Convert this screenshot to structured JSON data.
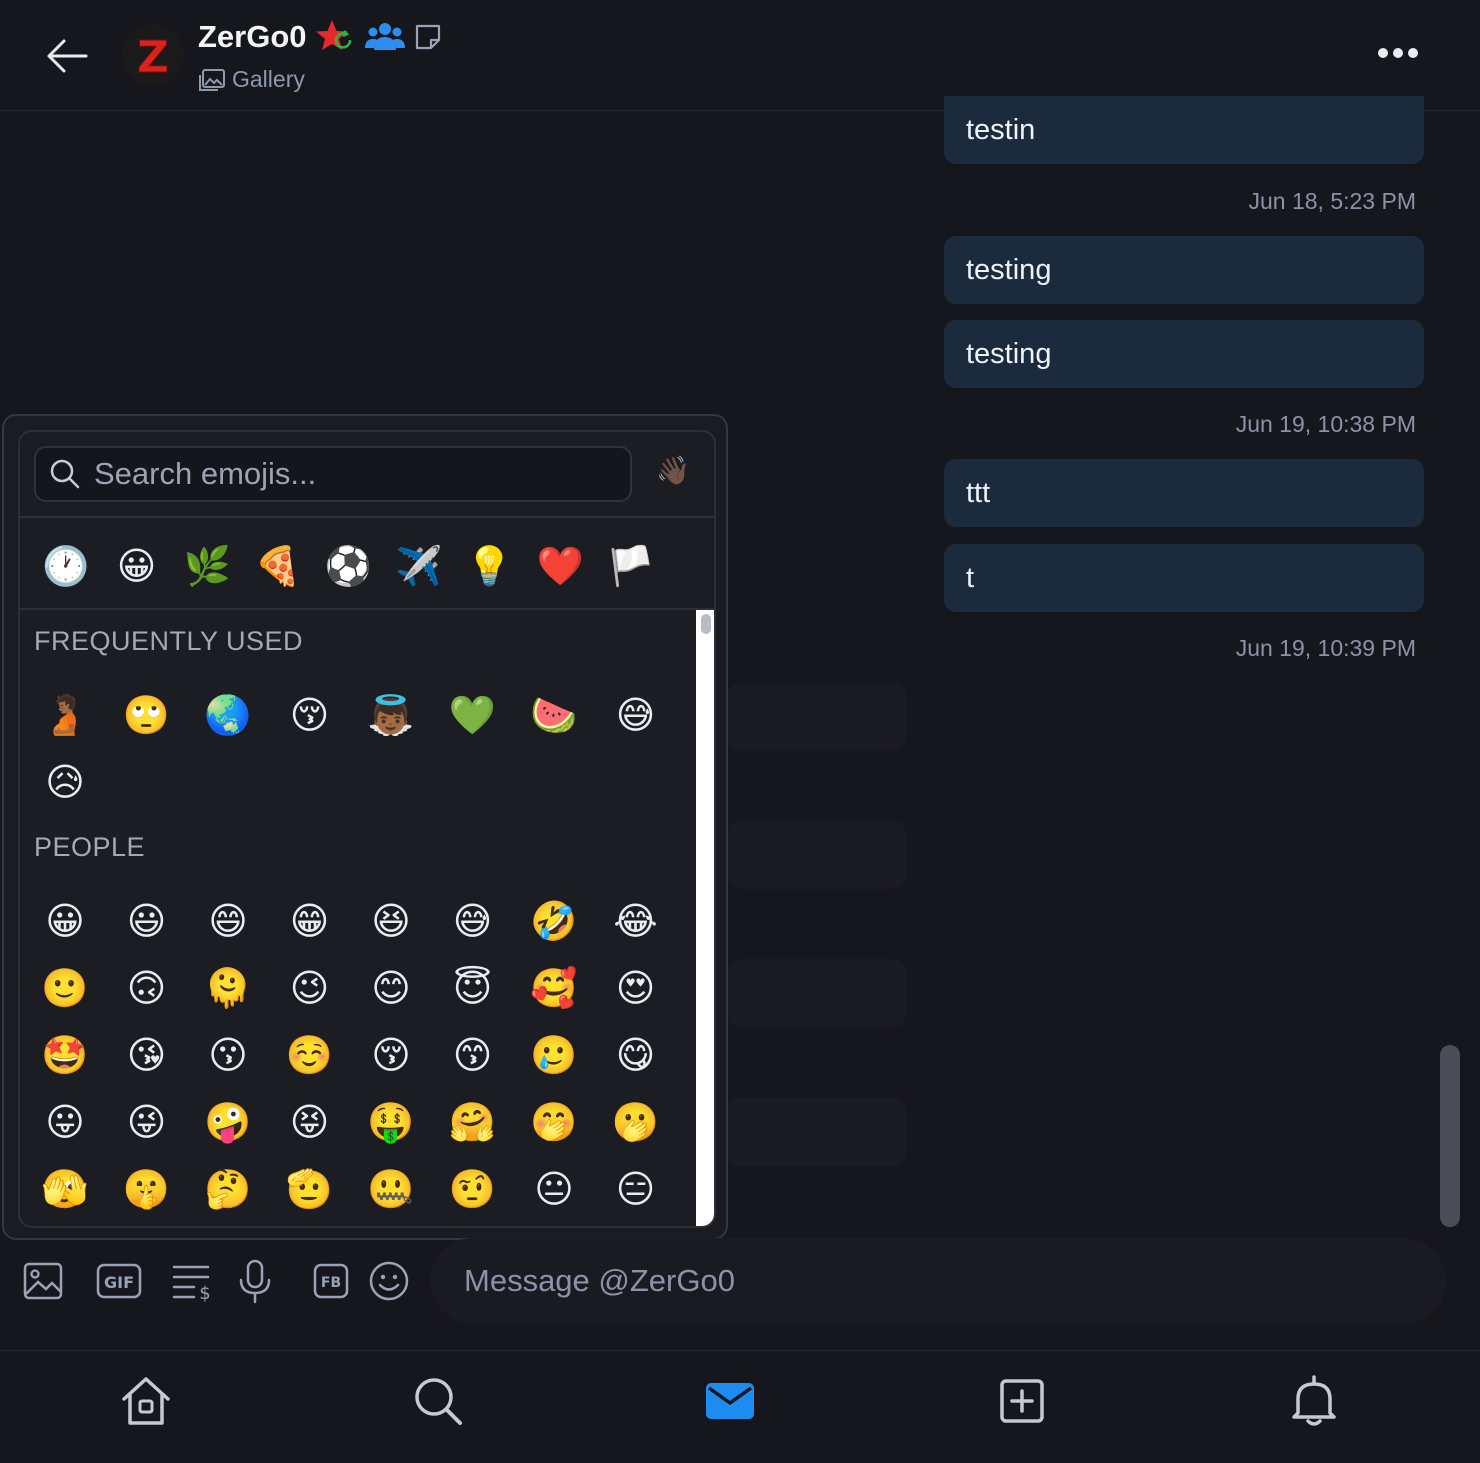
{
  "header": {
    "username": "ZerGo0",
    "avatar_letter": "Z",
    "subtitle": "Gallery"
  },
  "messages": [
    {
      "text": "testin"
    },
    {
      "text": "testing"
    },
    {
      "text": "testing"
    },
    {
      "text": "ttt"
    },
    {
      "text": "t"
    }
  ],
  "timestamps": [
    "Jun 18, 5:23 PM",
    "Jun 19, 10:38 PM",
    "Jun 19, 10:39 PM"
  ],
  "emoji_picker": {
    "search_placeholder": "Search emojis...",
    "skin_tone": "👋🏿",
    "categories": [
      {
        "name": "recent",
        "glyph": "🕐"
      },
      {
        "name": "people",
        "glyph": "😀"
      },
      {
        "name": "nature",
        "glyph": "🌿"
      },
      {
        "name": "food",
        "glyph": "🍕"
      },
      {
        "name": "activity",
        "glyph": "⚽"
      },
      {
        "name": "travel",
        "glyph": "✈️"
      },
      {
        "name": "objects",
        "glyph": "💡"
      },
      {
        "name": "symbols",
        "glyph": "❤️"
      },
      {
        "name": "flags",
        "glyph": "🏳️"
      }
    ],
    "sections": [
      {
        "title": "FREQUENTLY USED",
        "emojis": [
          "🫄🏾",
          "🙄",
          "🌏",
          "😚",
          "👼🏾",
          "💚",
          "🍉",
          "😅",
          "😥"
        ]
      },
      {
        "title": "PEOPLE",
        "emojis": [
          "😀",
          "😃",
          "😄",
          "😁",
          "😆",
          "😅",
          "🤣",
          "😂",
          "🙂",
          "🙃",
          "🫠",
          "😉",
          "😊",
          "😇",
          "🥰",
          "😍",
          "🤩",
          "😘",
          "😗",
          "☺️",
          "😚",
          "😙",
          "🥲",
          "😋",
          "😛",
          "😜",
          "🤪",
          "😝",
          "🤑",
          "🤗",
          "🤭",
          "🫢",
          "🫣",
          "🤫",
          "🤔",
          "🫡",
          "🤐",
          "🤨",
          "😐",
          "😑"
        ]
      }
    ]
  },
  "composer": {
    "placeholder": "Message @ZerGo0",
    "tools": [
      "image-icon",
      "gif-icon",
      "paid-text-icon",
      "microphone-icon",
      "fb-icon",
      "emoji-icon"
    ],
    "gif_label": "GIF",
    "fb_label": "FB"
  },
  "nav": [
    "home-icon",
    "search-icon",
    "messages-icon",
    "add-post-icon",
    "notifications-icon"
  ],
  "colors": {
    "background": "#16171c",
    "bubble": "#1b2a3d",
    "accent": "#1d8cf0",
    "muted": "#8a93a8"
  }
}
